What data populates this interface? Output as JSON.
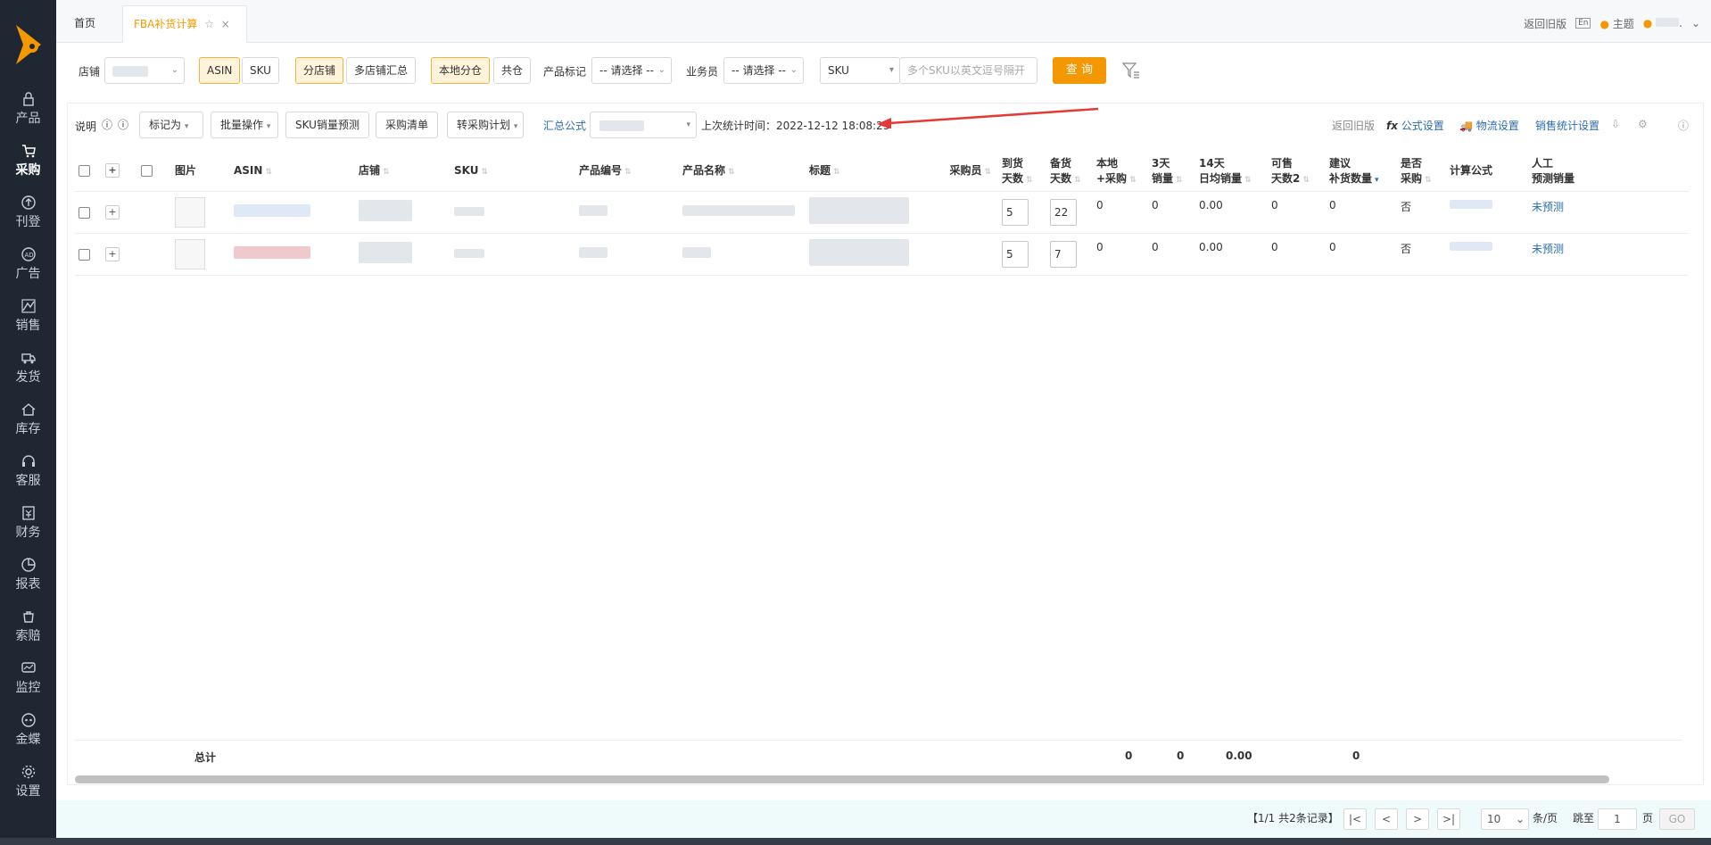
{
  "sidebar": {
    "items": [
      {
        "label": "产品",
        "icon": "lock-icon"
      },
      {
        "label": "采购",
        "icon": "cart-icon"
      },
      {
        "label": "刊登",
        "icon": "upload-icon"
      },
      {
        "label": "广告",
        "icon": "ad-icon"
      },
      {
        "label": "销售",
        "icon": "sales-icon"
      },
      {
        "label": "发货",
        "icon": "truck-icon"
      },
      {
        "label": "库存",
        "icon": "home-icon"
      },
      {
        "label": "客服",
        "icon": "headset-icon"
      },
      {
        "label": "财务",
        "icon": "finance-icon"
      },
      {
        "label": "报表",
        "icon": "pie-chart-icon"
      },
      {
        "label": "索赔",
        "icon": "claim-icon"
      },
      {
        "label": "监控",
        "icon": "monitor-icon"
      },
      {
        "label": "金蝶",
        "icon": "kingdee-icon"
      },
      {
        "label": "设置",
        "icon": "gear-icon"
      }
    ],
    "active_index": 1
  },
  "tabs": {
    "home": "首页",
    "active": "FBA补货计算",
    "star": "☆",
    "close": "×"
  },
  "top_right": {
    "old_version": "返回旧版",
    "en": "En",
    "theme": "主题",
    "user_suffix": "."
  },
  "filters": {
    "shop_label": "店铺",
    "asin": "ASIN",
    "sku": "SKU",
    "split_shop": "分店铺",
    "multi_shop": "多店铺汇总",
    "local_split": "本地分仓",
    "shared_wh": "共仓",
    "product_tag_label": "产品标记",
    "product_tag_value": "-- 请选择 --",
    "buyer_label": "业务员",
    "buyer_value": "-- 请选择 --",
    "search_type": "SKU",
    "search_placeholder": "多个SKU以英文逗号隔开",
    "query_button": "查 询"
  },
  "toolbar": {
    "explain": "说明",
    "mark_as": "标记为",
    "batch_ops": "批量操作",
    "sku_forecast": "SKU销量预测",
    "purchase_list": "采购清单",
    "to_purchase_plan": "转采购计划",
    "summary_formula": "汇总公式",
    "last_stat_time": "上次统计时间：2022-12-12 18:08:23",
    "old_version": "返回旧版",
    "formula_settings": "公式设置",
    "logistics_settings": "物流设置",
    "sales_stat_settings": "销售统计设置"
  },
  "table": {
    "headers": {
      "image": "图片",
      "asin": "ASIN",
      "shop": "店铺",
      "sku": "SKU",
      "product_code": "产品编号",
      "product_name": "产品名称",
      "title": "标题",
      "buyer": "采购员",
      "arrival_days_1": "到货",
      "arrival_days_2": "天数",
      "stock_days_1": "备货",
      "stock_days_2": "天数",
      "local_1": "本地",
      "local_2": "+采购",
      "sales3_1": "3天",
      "sales3_2": "销量",
      "avg14_1": "14天",
      "avg14_2": "日均销量",
      "sellable_1": "可售",
      "sellable_2": "天数2",
      "suggest_1": "建议",
      "suggest_2": "补货数量",
      "purchase_1": "是否",
      "purchase_2": "采购",
      "formula": "计算公式",
      "manual_1": "人工",
      "manual_2": "预测销量"
    },
    "rows": [
      {
        "arrival": "5",
        "stock": "22",
        "local": "0",
        "sales3": "0",
        "avg14": "0.00",
        "sellable": "0",
        "suggest": "0",
        "purchase": "否",
        "manual": "未预测"
      },
      {
        "arrival": "5",
        "stock": "7",
        "local": "0",
        "sales3": "0",
        "avg14": "0.00",
        "sellable": "0",
        "suggest": "0",
        "purchase": "否",
        "manual": "未预测"
      }
    ],
    "summary": {
      "label": "总计",
      "local": "0",
      "sales3": "0",
      "avg14": "0.00",
      "suggest": "0"
    }
  },
  "pager": {
    "info": "【1/1  共2条记录】",
    "first": "|<",
    "prev": "<",
    "next": ">",
    "last": ">|",
    "page_size": "10",
    "per_page": "条/页",
    "goto_label": "跳至",
    "page_value": "1",
    "page_unit": "页",
    "go": "GO"
  },
  "colors": {
    "accent": "#f39800",
    "sidebar_bg": "#1f2733",
    "link": "#2b6cb0",
    "arrow": "#e53935"
  }
}
